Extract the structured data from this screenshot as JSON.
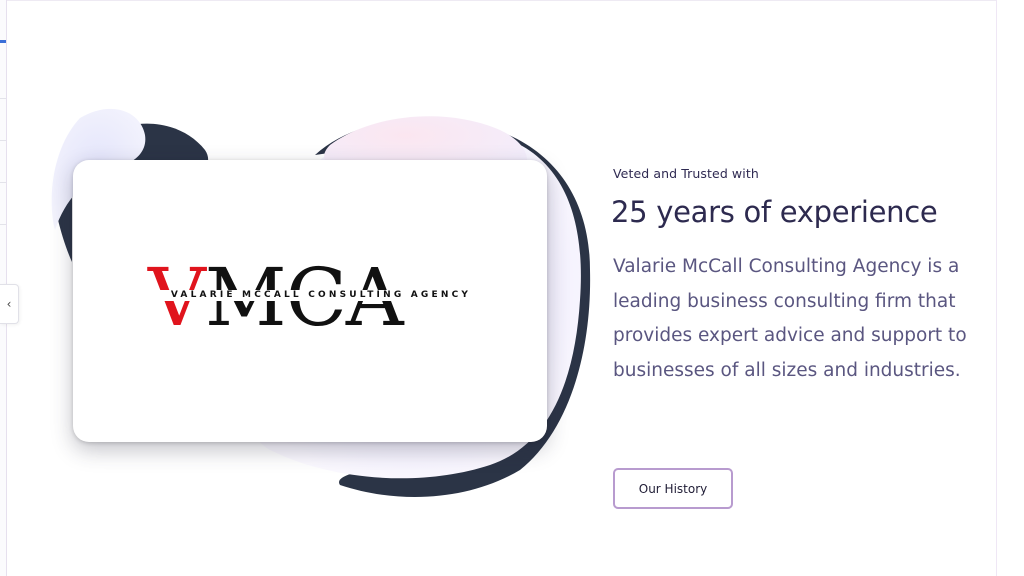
{
  "sidebar": {
    "collapse_icon": "chevron-left-icon",
    "collapse_glyph": "‹"
  },
  "hero": {
    "logo": {
      "initial": "V",
      "rest": "MCA",
      "tagline": "VALARIE MCCALL CONSULTING AGENCY",
      "colors": {
        "initial": "#e0141d",
        "rest": "#111111"
      }
    },
    "eyebrow": "Veted and Trusted with",
    "headline": "25 years of experience",
    "description": "Valarie McCall Consulting Agency is a leading business consulting firm that provides expert advice and support to businesses of all sizes and industries.",
    "cta_label": "Our History"
  },
  "theme": {
    "heading": "#2d2a4f",
    "body": "#5a5680",
    "button_border": "#b89bcf",
    "blob_dark": "#2b3446",
    "blob_light": "#eef0ff"
  }
}
